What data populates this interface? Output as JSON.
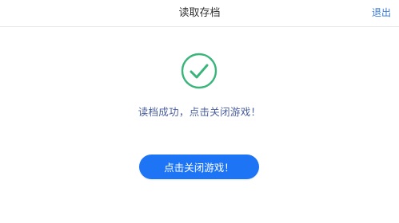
{
  "header": {
    "title": "读取存档",
    "action_label": "退出"
  },
  "status": {
    "icon": "check-circle-icon",
    "message": "读档成功，点击关闭游戏！"
  },
  "primary_button": {
    "label": "点击关闭游戏！"
  },
  "colors": {
    "success_green": "#39b57a",
    "message_blue": "#4a5f9e",
    "button_blue": "#1d74f5",
    "header_link_blue": "#3a7bd5"
  }
}
